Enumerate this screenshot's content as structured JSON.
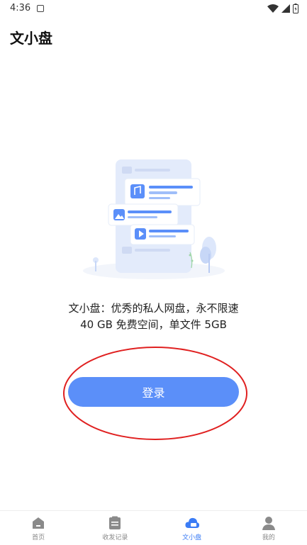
{
  "status_bar": {
    "time": "4:36"
  },
  "header": {
    "title": "文小盘"
  },
  "main": {
    "tagline_line1": "文小盘：优秀的私人网盘，永不限速",
    "tagline_line2": "40 GB 免费空间，单文件 5GB",
    "login_label": "登录"
  },
  "bottom_nav": {
    "items": [
      {
        "label": "首页",
        "icon": "home-icon"
      },
      {
        "label": "收发记录",
        "icon": "clipboard-icon"
      },
      {
        "label": "文小盘",
        "icon": "cloud-drive-icon",
        "active": true
      },
      {
        "label": "我的",
        "icon": "profile-icon"
      }
    ]
  },
  "colors": {
    "accent": "#5b8ff9",
    "active_tab": "#3b7cf5",
    "annotation": "#e02020"
  }
}
